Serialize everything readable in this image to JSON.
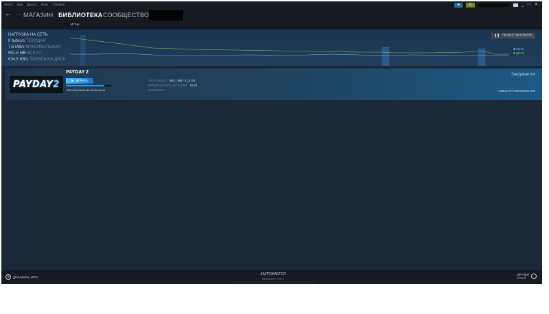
{
  "menu": [
    "Steam",
    "Вид",
    "Друзья",
    "Игры",
    "Справка"
  ],
  "titlebar": {
    "notification_glyph": "◄",
    "friends_count": "6",
    "controls": [
      "_",
      "▭",
      "✕"
    ]
  },
  "nav": {
    "back": "←",
    "forward": "→",
    "store": "МАГАЗИН",
    "library": "БИБЛИОТЕКА",
    "community": "СООБЩЕСТВО"
  },
  "subnav": {
    "games_tab": "ИГРЫ"
  },
  "stats": {
    "heading": "НАГРУЗКА НА СЕТЬ",
    "current_value": "0 bytes/s",
    "current_label": "ТЕКУЩАЯ",
    "max_value": "7.6 MB/s",
    "max_label": "МАКСИМАЛЬНАЯ",
    "total_value": "551.8 MB",
    "total_label": "ВСЕГО",
    "disk_value": "634.5 KB/s",
    "disk_label": "ЗАПИСЬ НА ДИСК",
    "pause_label": "ПРИОСТАНОВИТЬ",
    "legend_net": "СЕТЬ",
    "legend_disk": "ДИСК"
  },
  "download": {
    "game_title": "PAYDAY 2",
    "cover_text_1": "PAYDAY",
    "cover_text_2": "2",
    "play_label": "ИГРАТЬ",
    "progress": 0.85,
    "autoupdate": "Автообновления включены",
    "downloaded_label": "ЗАГРУЖЕНО:",
    "downloaded_value": "556.1 MB / 21.5 GB",
    "start_label": "ВРЕМЯ НАЧАЛА ЗАГРУЗКИ:",
    "start_value": "16:40",
    "remaining_label": "ОСТАЛОСЬ:",
    "status": "Загружается",
    "news": "НОВОСТИ ОБНОВЛЕНИЯ"
  },
  "bottom": {
    "add_game": "ДОБАВИТЬ ИГРУ",
    "status_title": "ЗАГРУЖАЕТСЯ",
    "status_sub": "Загружено: 0 из 1",
    "friends_line1": "ДРУЗЬЯ",
    "friends_line2": "И ЧАТ"
  },
  "colors": {
    "background": "#1b2838",
    "topbar": "#171a21",
    "accent": "#66c0f4",
    "disk": "#8bc53f"
  }
}
